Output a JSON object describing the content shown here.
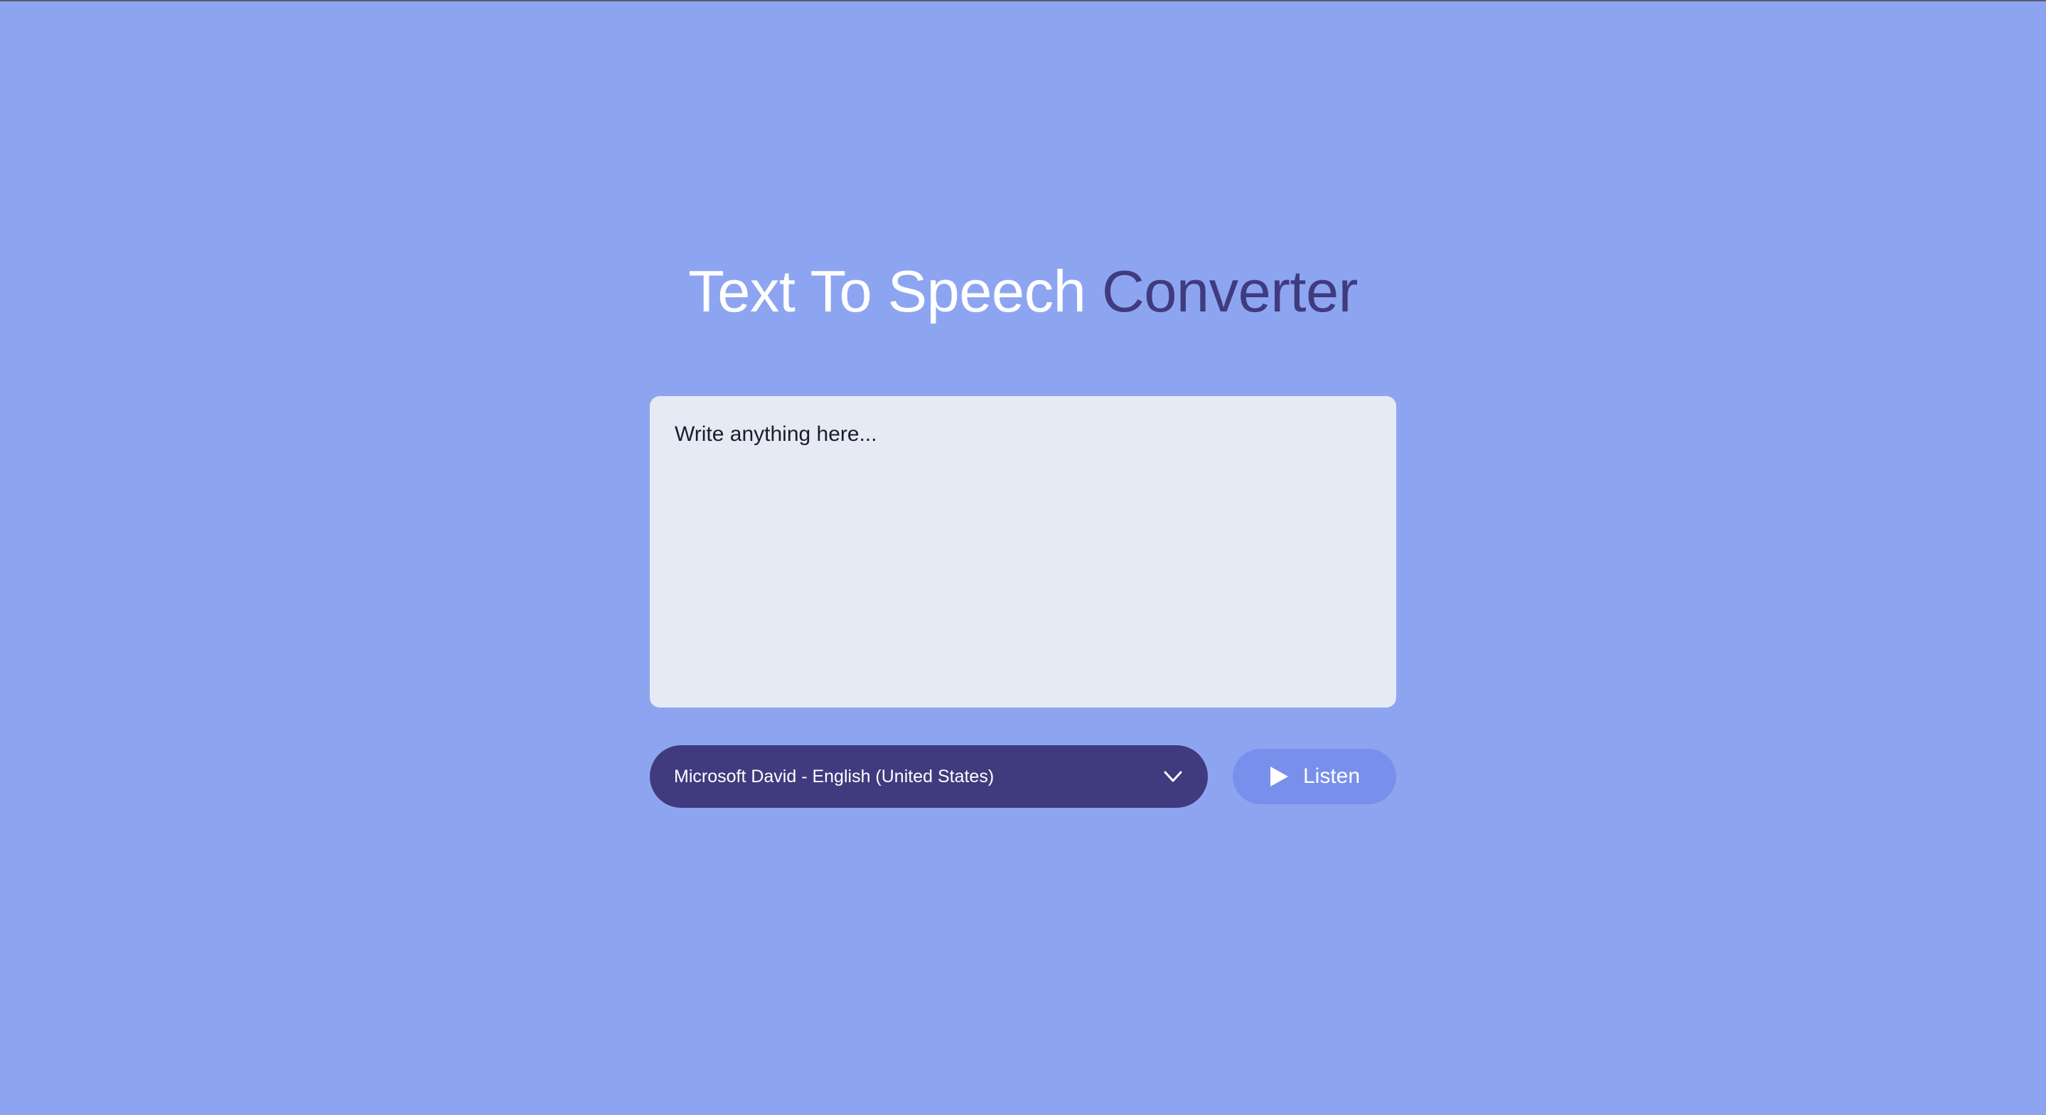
{
  "header": {
    "title_part1": "Text To Speech",
    "title_part2": "Converter"
  },
  "editor": {
    "placeholder": "Write anything here...",
    "value": ""
  },
  "voice_select": {
    "selected": "Microsoft David - English (United States)",
    "icon": "chevron-down-icon"
  },
  "listen_button": {
    "label": "Listen",
    "icon": "play-icon"
  },
  "colors": {
    "background": "#8da5f1",
    "accent_dark": "#403b7e",
    "button": "#7890eb",
    "textarea_bg": "#e6eaf4"
  }
}
